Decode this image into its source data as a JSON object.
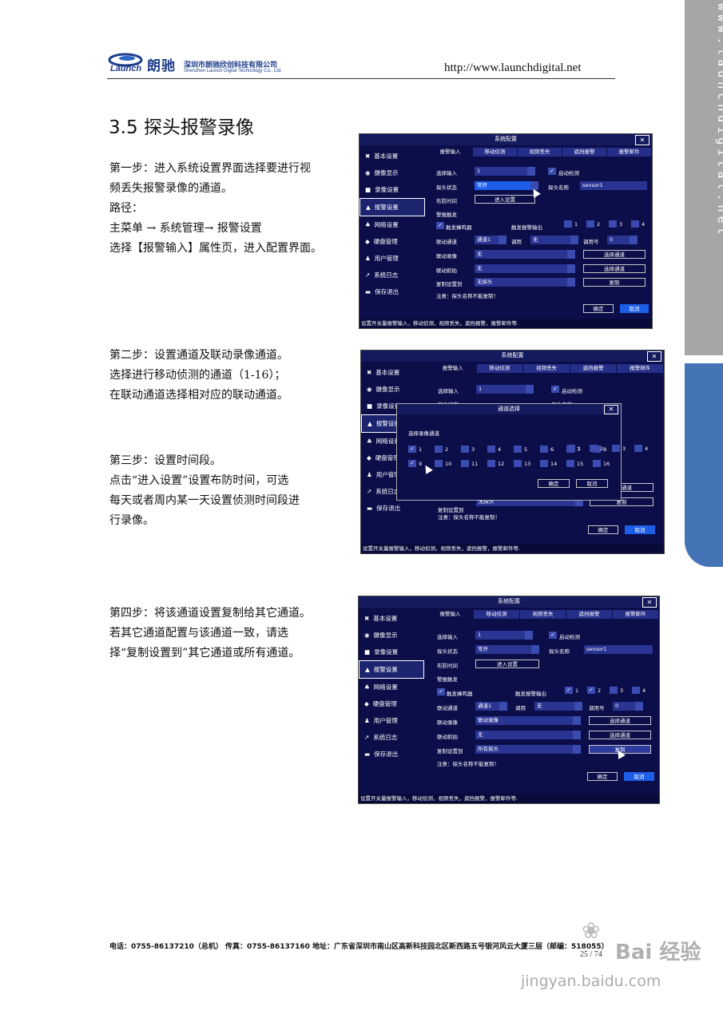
{
  "header": {
    "brand_en": "Launch",
    "brand_cn": "朗驰",
    "company_cn": "深圳市朗驰欣创科技有限公司",
    "company_en": "Shenzhen Launch Digital Technology Co., Ltd.",
    "url": "http://www.launchdigital.net"
  },
  "side_tab": {
    "text": "www.launchdigital.net"
  },
  "section_title": "3.5  探头报警录像",
  "steps": [
    "第一步：进入系统设置界面选择要进行视\n频丢失报警录像的通道。\n路径：\n主菜单 → 系统管理→ 报警设置\n选择【报警输入】属性页，进入配置界面。",
    "第二步：设置通道及联动录像通道。\n选择进行移动侦测的通道（1-16）；\n在联动通道选择相对应的联动通道。",
    "第三步：设置时间段。\n点击“进入设置”设置布防时间，可选\n每天或者周内某一天设置侦测时间段进\n行录像。",
    "第四步：将该通道设置复制给其它通道。\n若其它通道配置与该通道一致，请选\n择“复制设置到”其它通道或所有通道。"
  ],
  "ui": {
    "window_title": "系统配置",
    "close": "✕",
    "menu": [
      "基本设置",
      "摄像显示",
      "录像设置",
      "报警设置",
      "网络设置",
      "硬盘管理",
      "用户管理",
      "系统日志",
      "保存退出"
    ],
    "menu_icons": [
      "wrench-icon",
      "eye-icon",
      "record-icon",
      "alarm-icon",
      "network-icon",
      "disk-icon",
      "user-icon",
      "log-icon",
      "save-icon"
    ],
    "menu_glyphs": [
      "✖",
      "◉",
      "■",
      "▲",
      "♣",
      "◆",
      "♟",
      "↗",
      "▬"
    ],
    "tabs": [
      "报警输入",
      "移动侦测",
      "视频丢失",
      "遮挡报警",
      "报警邮件"
    ],
    "labels": {
      "alarm_input": "选择输入",
      "probe_state": "探头状态",
      "schedule": "布防时间",
      "alarm_trigger": "警报触发",
      "buzzer": "触发蜂鸣器",
      "alarm_out": "触发报警输出",
      "link_channel": "联动通道",
      "call": "调用",
      "preset": "调用号",
      "link_record": "联动录像",
      "link_snap": "联动抓拍",
      "copy_to": "复制设置到",
      "enable_detect": "启动检测",
      "probe_name": "探头名称",
      "note": "注意：探头名称不能复制！"
    },
    "values": {
      "input": "1",
      "state": "常开",
      "name": "sensor1",
      "channel": "通道1",
      "call_val": "无",
      "preset_val": "0",
      "none": "无",
      "no_probe": "无探头",
      "all_probe": "所有探头",
      "link_rec_s3": "联动录像"
    },
    "buttons": {
      "enter_setup": "进入设置",
      "choose_channel": "选择通道",
      "copy": "复制",
      "ok": "确定",
      "cancel": "取消"
    },
    "alarm_out_nums": [
      "1",
      "2",
      "3",
      "4"
    ],
    "hint": "设置开关量报警输入，移动侦测，视频丢失，遮挡报警，报警邮件等.",
    "dialog": {
      "title": "通道选择",
      "subtitle": "选择录像通道",
      "channels": [
        "1",
        "2",
        "3",
        "4",
        "5",
        "6",
        "7",
        "8",
        "9",
        "10",
        "11",
        "12",
        "13",
        "14",
        "15",
        "16"
      ],
      "checked": [
        "1",
        "9"
      ]
    }
  },
  "footer": {
    "contact": "电话：0755-86137210（总机）   传真：0755-86137160   地址：广东省深圳市南山区高新科技园北区新西路五号银河风云大厦三层（邮编：518055）",
    "page": "25 / 74"
  },
  "watermark": {
    "text": "Bai 经验",
    "url": "jingyan.baidu.com"
  }
}
